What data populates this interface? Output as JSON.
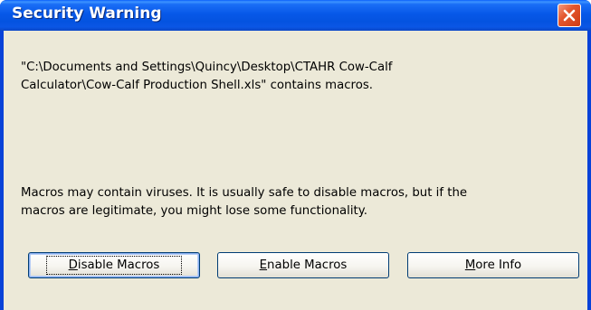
{
  "window": {
    "title": "Security Warning"
  },
  "message": {
    "file_line1": "\"C:\\Documents and Settings\\Quincy\\Desktop\\CTAHR Cow-Calf",
    "file_line2": "Calculator\\Cow-Calf Production Shell.xls\" contains macros.",
    "warning_line1": "Macros may contain viruses. It is usually safe to disable macros, but if the",
    "warning_line2": "macros are legitimate, you might lose some functionality."
  },
  "buttons": {
    "disable": {
      "mnemonic": "D",
      "rest": "isable Macros"
    },
    "enable": {
      "mnemonic": "E",
      "rest": "nable Macros"
    },
    "more_info": {
      "mnemonic": "M",
      "rest": "ore Info"
    }
  },
  "icons": {
    "close": "close-icon"
  },
  "colors": {
    "titlebar": "#0554e3",
    "close_button": "#e0522b",
    "dialog_face": "#ece9d8",
    "button_border": "#003c74"
  }
}
